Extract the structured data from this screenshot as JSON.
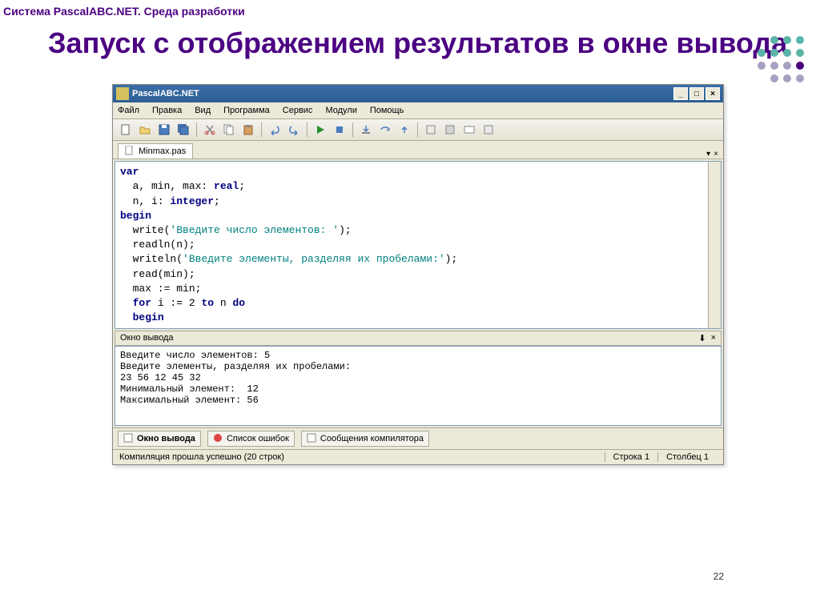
{
  "slide": {
    "header": "Система PascalABC.NET. Среда разработки",
    "title": "Запуск с отображением результатов в окне вывода",
    "page_num": "22"
  },
  "ide": {
    "title": "PascalABC.NET",
    "menus": [
      "Файл",
      "Правка",
      "Вид",
      "Программа",
      "Сервис",
      "Модули",
      "Помощь"
    ],
    "tab_name": "Minmax.pas",
    "code": [
      {
        "t": "var",
        "cls": "kw"
      },
      {
        "t": "  a, min, max: ",
        "extra": "real",
        "extra_cls": "kw",
        "tail": ";"
      },
      {
        "t": "  n, i: ",
        "extra": "integer",
        "extra_cls": "kw",
        "tail": ";"
      },
      {
        "t": "begin",
        "cls": "kw"
      },
      {
        "t": "  write(",
        "extra": "'Введите число элементов: '",
        "extra_cls": "str",
        "tail": ");"
      },
      {
        "t": "  readln(n);"
      },
      {
        "t": "  writeln(",
        "extra": "'Введите элементы, разделяя их пробелами:'",
        "extra_cls": "str",
        "tail": ");"
      },
      {
        "t": "  read(min);"
      },
      {
        "t": "  max := min;"
      },
      {
        "t": "  ",
        "extra": "for",
        "extra_cls": "kw",
        "mid": " i := 2 ",
        "extra2": "to",
        "extra2_cls": "kw",
        "mid2": " n ",
        "extra3": "do",
        "extra3_cls": "kw"
      },
      {
        "t": "  ",
        "extra": "begin",
        "extra_cls": "kw"
      }
    ],
    "output_title": "Окно вывода",
    "output": "Введите число элементов: 5\nВведите элементы, разделяя их пробелами:\n23 56 12 45 32\nМинимальный элемент:  12\nМаксимальный элемент: 56",
    "bottom_tabs": [
      {
        "label": "Окно вывода",
        "active": true
      },
      {
        "label": "Список ошибок",
        "active": false
      },
      {
        "label": "Сообщения компилятора",
        "active": false
      }
    ],
    "status": {
      "compile": "Компиляция прошла успешно (20 строк)",
      "line": "Строка  1",
      "col": "Столбец  1"
    }
  }
}
